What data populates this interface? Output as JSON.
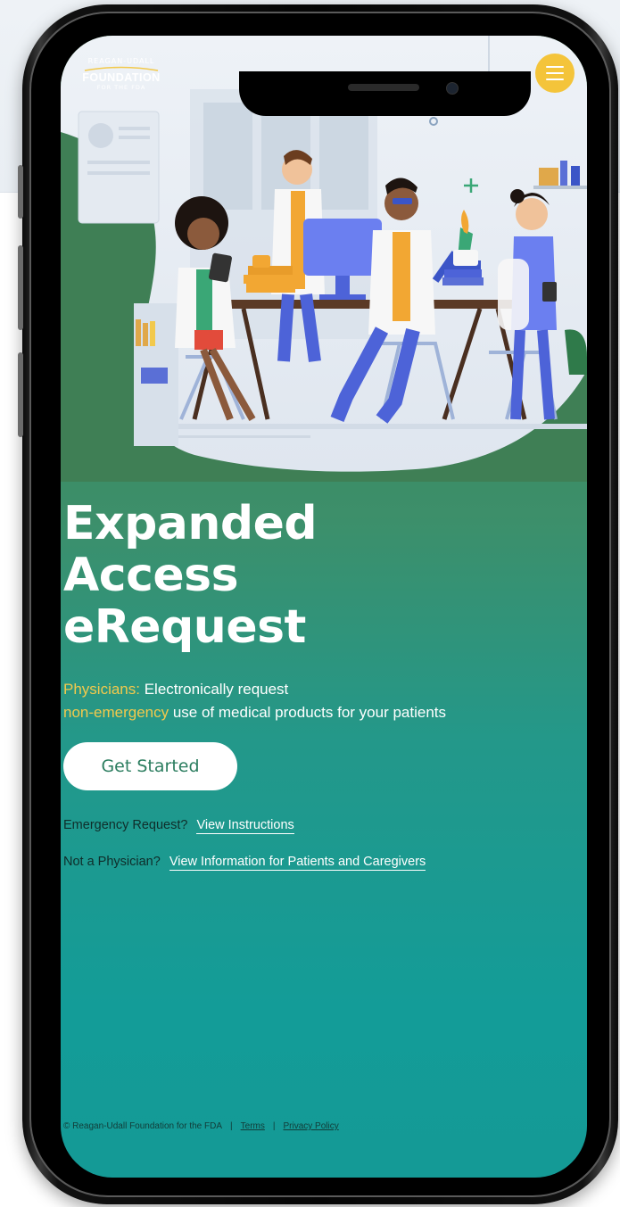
{
  "brand": {
    "logo_top": "REAGAN-UDALL",
    "logo_main": "FOUNDATION",
    "logo_sub": "FOR THE FDA"
  },
  "menu_icon": "hamburger-menu-icon",
  "hero": {
    "headline_lines": [
      "Expanded",
      "Access",
      "eRequest"
    ],
    "sub_prefix": "Physicians:",
    "sub_line1_rest": " Electronically request",
    "sub_highlight": "non-emergency",
    "sub_line2_rest": " use of medical products for your patients",
    "cta_label": "Get Started"
  },
  "links": {
    "emergency_prompt": "Emergency Request?",
    "emergency_link": "View Instructions",
    "nonphysician_prompt": "Not a Physician?",
    "nonphysician_link": "View Information for Patients and Caregivers"
  },
  "footer": {
    "copyright": "© Reagan-Udall Foundation for the FDA",
    "separator": "|",
    "terms": "Terms",
    "privacy": "Privacy Policy"
  },
  "colors": {
    "accent_yellow": "#f2c94c",
    "gradient_top": "#2f7a4a",
    "gradient_bottom": "#149a96",
    "cta_text": "#2b7d5f",
    "menu_button": "#f4c43a"
  }
}
